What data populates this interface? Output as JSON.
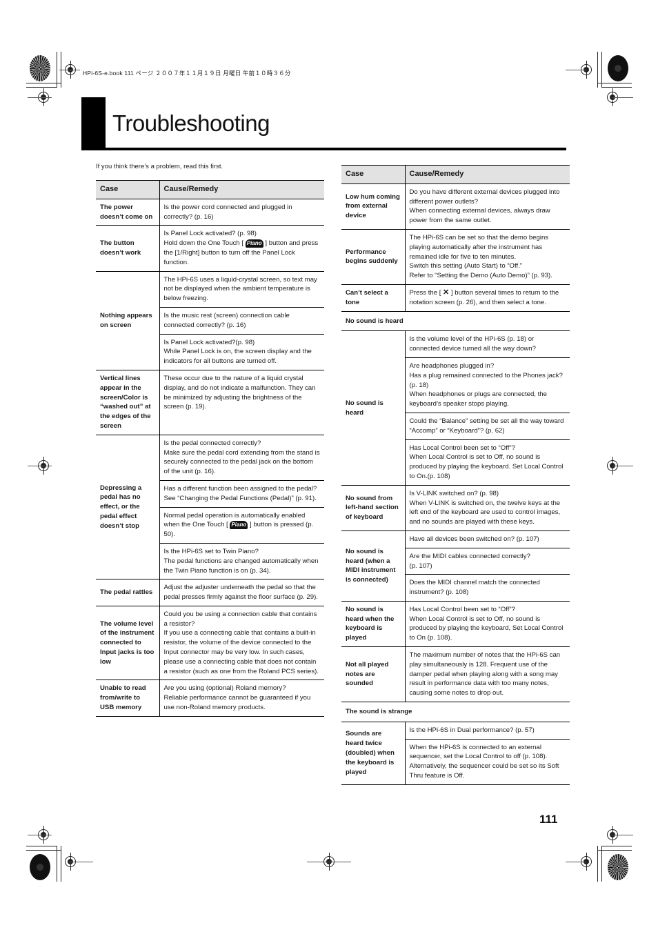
{
  "header": {
    "print_info": "HPi-6S-e.book  111 ページ  ２００７年１１月１９日  月曜日  午前１０時３６分"
  },
  "title": "Troubleshooting",
  "intro": "If you think there’s a problem, read this first.",
  "page_number": "111",
  "left_table": {
    "headers": {
      "case": "Case",
      "remedy": "Cause/Remedy"
    },
    "rows": [
      {
        "case": "The power doesn’t come on",
        "remedies": [
          "Is the power cord connected and plugged in correctly? (p. 16)"
        ]
      },
      {
        "case": "The button doesn’t work",
        "remedies": [
          "Is Panel Lock activated? (p. 98)\nHold down the One Touch [ {piano} ] button and press the [1/Right] button to turn off the Panel Lock function."
        ]
      },
      {
        "case": "Nothing appears on screen",
        "remedies": [
          "The HPi-6S uses a liquid-crystal screen, so text may not be displayed when the ambient temperature is below freezing.",
          "Is the music rest (screen) connection cable connected correctly? (p. 16)",
          "Is Panel Lock activated?(p. 98)\nWhile Panel Lock is on, the screen display and the indicators for all buttons are turned off."
        ]
      },
      {
        "case": "Vertical lines appear in the screen/Color is “washed out” at the edges of the screen",
        "remedies": [
          "These occur due to the nature of a liquid crystal display, and do not indicate a malfunction. They can be minimized by adjusting the brightness of the screen (p. 19)."
        ]
      },
      {
        "case": "Depressing a pedal has no effect, or the pedal effect doesn’t stop",
        "remedies": [
          "Is the pedal connected correctly?\nMake sure the pedal cord extending from the stand is securely connected to the pedal jack on the bottom of the unit (p. 16).",
          "Has a different function been assigned to the pedal?\nSee “Changing the Pedal Functions (Pedal)” (p. 91).",
          "Normal pedal operation is automatically enabled when the One Touch [ {piano} ] button is pressed (p. 50).",
          "Is the HPi-6S set to Twin Piano?\nThe pedal functions are changed automatically when the Twin Piano function is on (p. 34)."
        ]
      },
      {
        "case": "The pedal rattles",
        "remedies": [
          "Adjust the adjuster underneath the pedal so that the pedal presses firmly against the floor surface (p. 29)."
        ]
      },
      {
        "case": "The volume level of the instrument connected to Input jacks is too low",
        "remedies": [
          "Could you be using a connection cable that contains a resistor?\nIf you use a connecting cable that contains a built-in resistor, the volume of the device connected to the Input connector may be very low. In such cases, please use a connecting cable that does not contain a resistor (such as one from the Roland PCS series)."
        ]
      },
      {
        "case": "Unable to read from/write to USB memory",
        "remedies": [
          "Are you using (optional) Roland memory?\nReliable performance cannot be guaranteed if you use non-Roland memory products."
        ]
      }
    ]
  },
  "right_table": {
    "headers": {
      "case": "Case",
      "remedy": "Cause/Remedy"
    },
    "rows": [
      {
        "case": "Low hum coming from external device",
        "remedies": [
          "Do you have different external devices plugged into different power outlets?\nWhen connecting external devices, always draw power from the same outlet."
        ]
      },
      {
        "case": "Performance begins suddenly",
        "remedies": [
          "The HPi-6S can be set so that the demo begins playing automatically after the instrument has remained idle for five to ten minutes.\nSwitch this setting (Auto Start) to “Off.”\nRefer to “Setting the Demo (Auto Demo)” (p. 93)."
        ]
      },
      {
        "case": "Can’t select a tone",
        "remedies": [
          "Press the [ {x} ] button several times to return to the notation screen (p. 26), and then select a tone."
        ]
      },
      {
        "section": "No sound is heard"
      },
      {
        "case": "No sound is heard",
        "remedies": [
          "Is the volume level of the HPi-6S (p. 18) or connected device turned all the way down?",
          "Are headphones plugged in?\nHas a plug remained connected to the Phones jack? (p. 18)\nWhen headphones or plugs are connected, the keyboard’s speaker stops playing.",
          "Could the “Balance” setting be set all the way toward “Accomp” or “Keyboard”? (p. 62)",
          "Has Local Control been set to “Off”?\nWhen Local Control is set to Off, no sound is produced by playing the keyboard. Set Local Control to On.(p. 108)"
        ]
      },
      {
        "case": "No sound from left-hand section of keyboard",
        "remedies": [
          "Is V-LINK switched on? (p. 98)\nWhen V-LINK is switched on, the twelve keys at the left end of the keyboard are used to control images, and no sounds are played with these keys."
        ]
      },
      {
        "case": "No sound is heard (when a MIDI instrument is connected)",
        "remedies": [
          "Have all devices been switched on? (p. 107)",
          "Are the MIDI cables connected correctly?\n(p. 107)",
          "Does the MIDI channel match the connected instrument? (p. 108)"
        ]
      },
      {
        "case": "No sound is heard when the keyboard is played",
        "remedies": [
          "Has Local Control been set to “Off”?\nWhen Local Control is set to Off, no sound is produced by playing the keyboard, Set Local Control to On (p. 108)."
        ]
      },
      {
        "case": "Not all played notes are sounded",
        "remedies": [
          "The maximum number of notes that the HPi-6S can play simultaneously is 128. Frequent use of the damper pedal when playing along with a song may result in performance data with too many notes, causing some notes to drop out."
        ]
      },
      {
        "section": "The sound is strange"
      },
      {
        "case": "Sounds are heard twice (doubled) when the keyboard is played",
        "remedies": [
          "Is the HPi-6S in Dual performance? (p. 57)",
          "When the HPi-6S is connected to an external sequencer, set the Local Control to off (p. 108). Alternatively, the sequencer could be set so its Soft Thru feature is Off."
        ]
      }
    ]
  },
  "icons": {
    "piano_button": {
      "name": "piano-button-icon",
      "label": "Piano"
    },
    "exit_button": {
      "name": "exit-x-icon",
      "glyph": "✕"
    }
  }
}
